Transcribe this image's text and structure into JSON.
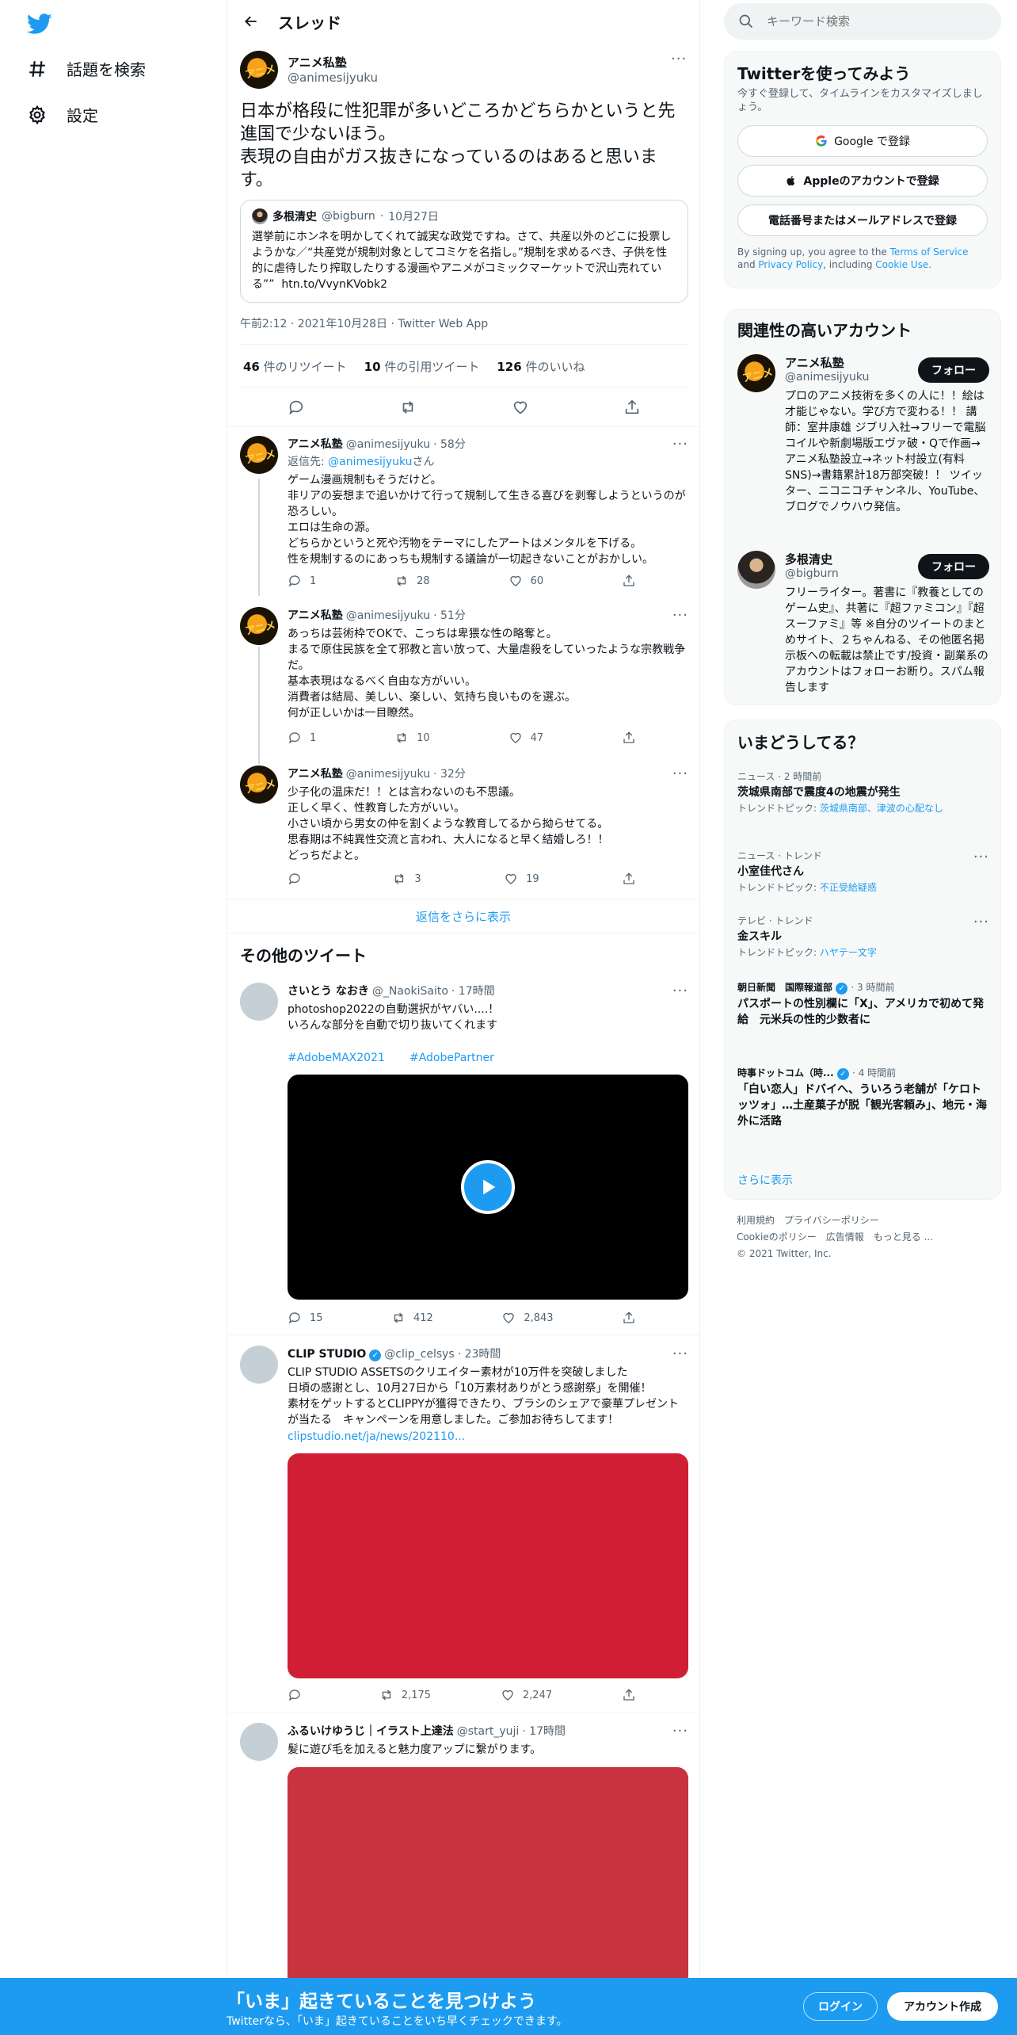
{
  "nav": {
    "explore_label": "話題を検索",
    "settings_label": "設定"
  },
  "header": {
    "title": "スレッド"
  },
  "main_tweet": {
    "name": "アニメ私塾",
    "handle": "@animesijyuku",
    "text": "日本が格段に性犯罪が多いどころかどちらかというと先進国で少ないほう。\n表現の自由がガス抜きになっているのはあると思います。",
    "quote": {
      "name": "多根清史",
      "handle": "@bigburn",
      "date": "10月27日",
      "text": "選挙前にホンネを明かしてくれて誠実な政党ですね。さて、共産以外のどこに投票しようかな／“共産党が規制対象としてコミケを名指し。”規制を求めるべき、子供を性的に虐待したり搾取したりする漫画やアニメがコミックマーケットで沢山売れている””  htn.to/VvynKVobk2"
    },
    "meta": "午前2:12 · 2021年10月28日 · Twitter Web App",
    "retweets_count": "46",
    "retweets_label": "件のリツイート",
    "quotes_count": "10",
    "quotes_label": "件の引用ツイート",
    "likes_count": "126",
    "likes_label": "件のいいね"
  },
  "replies": [
    {
      "name": "アニメ私塾",
      "handle": "@animesijyuku",
      "time": "· 58分",
      "replying_prefix": "返信先: ",
      "replying_handle": "@animesijyuku",
      "replying_suffix": "さん",
      "text": "ゲーム漫画規制もそうだけど。\n非リアの妄想まで追いかけて行って規制して生きる喜びを剥奪しようというのが恐ろしい。\nエロは生命の源。\nどちらかというと死や汚物をテーマにしたアートはメンタルを下げる。\n性を規制するのにあっちも規制する議論が一切起きないことがおかしい。",
      "replies": "1",
      "retweets": "28",
      "likes": "60"
    },
    {
      "name": "アニメ私塾",
      "handle": "@animesijyuku",
      "time": "· 51分",
      "text": "あっちは芸術枠でOKで、こっちは卑猥な性の略奪と。\nまるで原住民族を全て邪教と言い放って、大量虐殺をしていったような宗教戦争だ。\n基本表現はなるべく自由な方がいい。\n消費者は結局、美しい、楽しい、気持ち良いものを選ぶ。\n何が正しいかは一目瞭然。",
      "replies": "1",
      "retweets": "10",
      "likes": "47"
    },
    {
      "name": "アニメ私塾",
      "handle": "@animesijyuku",
      "time": "· 32分",
      "text": "少子化の温床だ！！とは言わないのも不思議。\n正しく早く、性教育した方がいい。\n小さい頃から男女の仲を割くような教育してるから拗らせてる。\n思春期は不純異性交流と言われ、大人になると早く結婚しろ！！\nどっちだよと。",
      "replies": "",
      "retweets": "3",
      "likes": "19"
    }
  ],
  "show_more_replies": "返信をさらに表示",
  "other_tweets_title": "その他のツイート",
  "other_tweets": [
    {
      "name": "さいとう なおき",
      "handle": "@_NaokiSaito",
      "time": "· 17時間",
      "text": "photoshop2022の自動選択がヤバい....！\nいろんな部分を自動で切り抜いてくれます",
      "tags": [
        "#AdobeMAX2021",
        "#AdobePartner"
      ],
      "replies": "15",
      "retweets": "412",
      "likes": "2,843"
    },
    {
      "name": "CLIP STUDIO",
      "handle": "@clip_celsys",
      "time": "· 23時間",
      "text": "CLIP STUDIO ASSETSのクリエイター素材が10万件を突破しました\n日頃の感謝とし、10月27日から「10万素材ありがとう感謝祭」を開催！\n素材をゲットするとCLIPPYが獲得できたり、ブラシのシェアで豪華プレゼントが当たる　キャンペーンを用意しました。ご参加お待ちしてます！",
      "link": "clipstudio.net/ja/news/202110...",
      "replies": "",
      "retweets": "2,175",
      "likes": "2,247"
    },
    {
      "name": "ふるいけゆうじ｜イラスト上達法",
      "handle": "@start_yuji",
      "time": "· 17時間",
      "text": "髪に遊び毛を加えると魅力度アップに繋がります。"
    }
  ],
  "search": {
    "placeholder": "キーワード検索"
  },
  "signup_panel": {
    "title": "Twitterを使ってみよう",
    "subtitle": "今すぐ登録して、タイムラインをカスタマイズしましょう。",
    "google_label": "Google で登録",
    "apple_label": "Appleのアカウントで登録",
    "phone_label": "電話番号またはメールアドレスで登録",
    "tos_prefix": "By signing up, you agree to the ",
    "tos_link": "Terms of Service",
    "tos_and": " and ",
    "privacy_link": "Privacy Policy",
    "tos_including": ", including ",
    "cookie_link": "Cookie Use",
    "tos_end": "."
  },
  "related_panel": {
    "title": "関連性の高いアカウント",
    "accounts": [
      {
        "name": "アニメ私塾",
        "handle": "@animesijyuku",
        "bio": "プロのアニメ技術を多くの人に！！絵は才能じゃない。学び方で変わる！！ 講師：室井康雄 ジブリ入社→フリーで電脳コイルや新劇場版エヴァ破・Qで作画→アニメ私塾設立→ネット村設立(有料SNS)→書籍累計18万部突破！！ ツイッター、ニコニコチャンネル、YouTube、ブログでノウハウ発信。",
        "follow_label": "フォロー"
      },
      {
        "name": "多根清史",
        "handle": "@bigburn",
        "bio": "フリーライター。著書に『教養としてのゲーム史』、共著に『超ファミコン』『超スーファミ』等 ※自分のツイートのまとめサイト、２ちゃんねる、その他匿名掲示板への転載は禁止です/投資・副業系のアカウントはフォローお断り。スパム報告します",
        "follow_label": "フォロー"
      }
    ]
  },
  "trends_panel": {
    "title": "いまどうしてる？",
    "items": [
      {
        "category": "ニュース · 2 時間前",
        "title": "茨城県南部で震度4の地震が発生",
        "sub_prefix": "トレンドトピック: ",
        "sub_link": "茨城県南部、津波の心配なし"
      },
      {
        "category": "ニュース · トレンド",
        "title": "小室佳代さん",
        "sub_prefix": "トレンドトピック: ",
        "sub_link": "不正受給疑惑"
      },
      {
        "category": "テレビ · トレンド",
        "title": "金スキル",
        "sub_prefix": "トレンドトピック: ",
        "sub_link": "ハヤテー文字"
      },
      {
        "category": "朝日新聞　国際報道部",
        "time": "· 3 時間前",
        "title": "パスポートの性別欄に「X」、アメリカで初めて発給　元米兵の性的少数者に"
      },
      {
        "category": "時事ドットコム（時...",
        "time": "· 4 時間前",
        "title": "「白い恋人」ドバイへ、ういろう老舗が「ケロトッツォ」…土産菓子が脱「観光客頼み」、地元・海外に活路"
      }
    ],
    "show_more": "さらに表示"
  },
  "footer": {
    "terms": "利用規約",
    "privacy": "プライバシーポリシー",
    "cookie": "Cookieのポリシー",
    "ads": "広告情報",
    "more": "もっと見る ...",
    "copyright": "© 2021 Twitter, Inc."
  },
  "banner": {
    "title": "「いま」起きていることを見つけよう",
    "subtitle": "Twitterなら、「いま」起きていることをいち早くチェックできます。",
    "login": "ログイン",
    "signup": "アカウント作成"
  },
  "colors": {
    "accent": "#1d9bf0",
    "text": "#0f1419",
    "muted": "#536471",
    "banner": "#1d9bf0",
    "media_red_1": "#d01f35",
    "media_red_2": "#c8333f"
  },
  "icons": [
    "twitter-logo-icon",
    "hashtag-icon",
    "gear-icon",
    "back-arrow-icon",
    "search-icon",
    "reply-icon",
    "retweet-icon",
    "like-icon",
    "share-icon",
    "play-icon",
    "google-icon",
    "apple-icon",
    "verified-icon",
    "more-icon"
  ]
}
